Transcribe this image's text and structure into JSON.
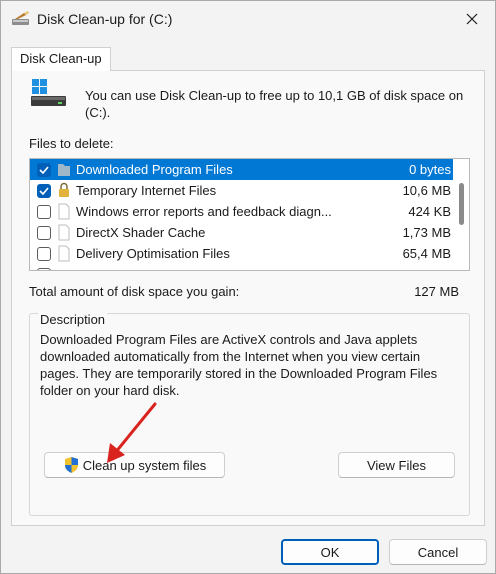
{
  "window": {
    "title": "Disk Clean-up for  (C:)",
    "tab_label": "Disk Clean-up"
  },
  "info": {
    "text": "You can use Disk Clean-up to free up to 10,1 GB of disk space on (C:)."
  },
  "files": {
    "label": "Files to delete:",
    "items": [
      {
        "name": "Downloaded Program Files",
        "size": "0 bytes",
        "checked": true,
        "selected": true,
        "icon": "folder-icon"
      },
      {
        "name": "Temporary Internet Files",
        "size": "10,6 MB",
        "checked": true,
        "selected": false,
        "icon": "lock-icon"
      },
      {
        "name": "Windows error reports and feedback diagn...",
        "size": "424 KB",
        "checked": false,
        "selected": false,
        "icon": "file-icon"
      },
      {
        "name": "DirectX Shader Cache",
        "size": "1,73 MB",
        "checked": false,
        "selected": false,
        "icon": "file-icon"
      },
      {
        "name": "Delivery Optimisation Files",
        "size": "65,4 MB",
        "checked": false,
        "selected": false,
        "icon": "file-icon"
      }
    ]
  },
  "total": {
    "label": "Total amount of disk space you gain:",
    "value": "127 MB"
  },
  "description": {
    "title": "Description",
    "text": "Downloaded Program Files are ActiveX controls and Java applets downloaded automatically from the Internet when you view certain pages. They are temporarily stored in the Downloaded Program Files folder on your hard disk."
  },
  "buttons": {
    "cleanup_system": "Clean up system files",
    "view_files": "View Files",
    "ok": "OK",
    "cancel": "Cancel"
  },
  "colors": {
    "accent": "#0078d4",
    "checkbox": "#005fb8",
    "annotation_arrow": "#d9231f"
  }
}
